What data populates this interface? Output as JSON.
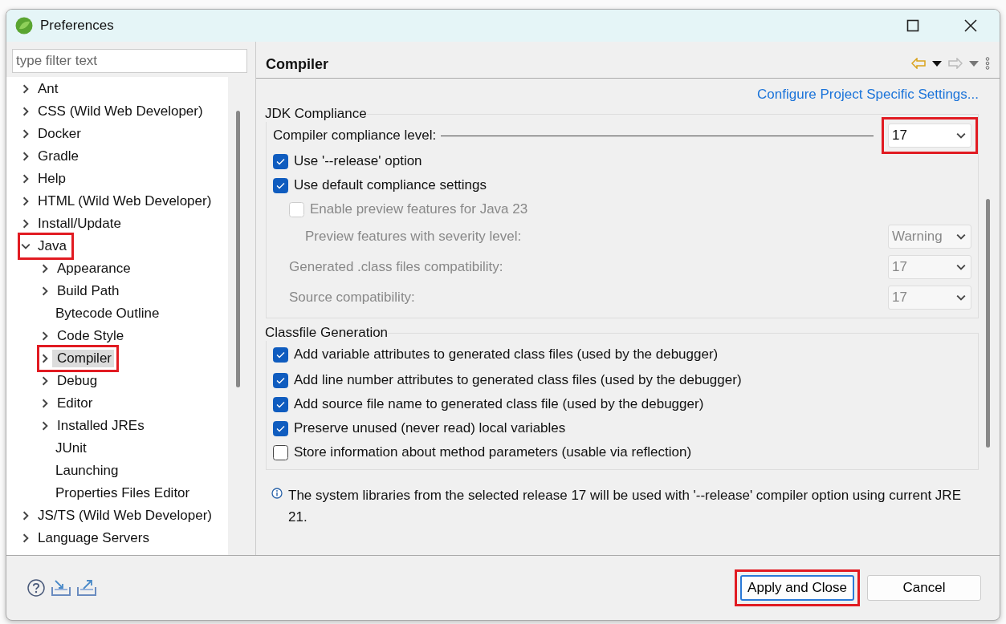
{
  "window": {
    "title": "Preferences"
  },
  "filter": {
    "placeholder": "type filter text"
  },
  "tree": [
    {
      "label": "Ant",
      "expandable": true,
      "expanded": false,
      "selected": false,
      "highlighted": false
    },
    {
      "label": "CSS (Wild Web Developer)",
      "expandable": true,
      "expanded": false,
      "selected": false,
      "highlighted": false
    },
    {
      "label": "Docker",
      "expandable": true,
      "expanded": false,
      "selected": false,
      "highlighted": false
    },
    {
      "label": "Gradle",
      "expandable": true,
      "expanded": false,
      "selected": false,
      "highlighted": false
    },
    {
      "label": "Help",
      "expandable": true,
      "expanded": false,
      "selected": false,
      "highlighted": false
    },
    {
      "label": "HTML (Wild Web Developer)",
      "expandable": true,
      "expanded": false,
      "selected": false,
      "highlighted": false
    },
    {
      "label": "Install/Update",
      "expandable": true,
      "expanded": false,
      "selected": false,
      "highlighted": false
    },
    {
      "label": "Java",
      "expandable": true,
      "expanded": true,
      "selected": false,
      "highlighted": true,
      "children": [
        {
          "label": "Appearance",
          "expandable": true,
          "expanded": false,
          "selected": false,
          "highlighted": false
        },
        {
          "label": "Build Path",
          "expandable": true,
          "expanded": false,
          "selected": false,
          "highlighted": false
        },
        {
          "label": "Bytecode Outline",
          "expandable": false,
          "selected": false,
          "highlighted": false
        },
        {
          "label": "Code Style",
          "expandable": true,
          "expanded": false,
          "selected": false,
          "highlighted": false
        },
        {
          "label": "Compiler",
          "expandable": true,
          "expanded": false,
          "selected": true,
          "highlighted": true
        },
        {
          "label": "Debug",
          "expandable": true,
          "expanded": false,
          "selected": false,
          "highlighted": false
        },
        {
          "label": "Editor",
          "expandable": true,
          "expanded": false,
          "selected": false,
          "highlighted": false
        },
        {
          "label": "Installed JREs",
          "expandable": true,
          "expanded": false,
          "selected": false,
          "highlighted": false
        },
        {
          "label": "JUnit",
          "expandable": false,
          "selected": false,
          "highlighted": false
        },
        {
          "label": "Launching",
          "expandable": false,
          "selected": false,
          "highlighted": false
        },
        {
          "label": "Properties Files Editor",
          "expandable": false,
          "selected": false,
          "highlighted": false
        }
      ]
    },
    {
      "label": "JS/TS (Wild Web Developer)",
      "expandable": true,
      "expanded": false,
      "selected": false,
      "highlighted": false
    },
    {
      "label": "Language Servers",
      "expandable": true,
      "expanded": false,
      "selected": false,
      "highlighted": false
    }
  ],
  "page": {
    "title": "Compiler",
    "back_enabled": true,
    "forward_enabled": false,
    "link": "Configure Project Specific Settings..."
  },
  "groups": [
    {
      "title": "JDK Compliance",
      "options": [
        {
          "kind": "combo",
          "label": "Compiler compliance level:",
          "value": "17",
          "disabled": false,
          "highlighted": true,
          "leader": true
        },
        {
          "kind": "checkbox",
          "label": "Use '--release' option",
          "checked": true,
          "disabled": false
        },
        {
          "kind": "checkbox",
          "label": "Use default compliance settings",
          "checked": true,
          "disabled": false,
          "children": [
            {
              "kind": "checkbox",
              "label": "Enable preview features for Java 23",
              "checked": false,
              "disabled": true,
              "children": [
                {
                  "kind": "combo",
                  "label": "Preview features with severity level:",
                  "value": "Warning",
                  "disabled": true,
                  "highlighted": false
                }
              ]
            },
            {
              "kind": "combo",
              "label": "Generated .class files compatibility:",
              "value": "17",
              "disabled": true,
              "highlighted": false
            },
            {
              "kind": "combo",
              "label": "Source compatibility:",
              "value": "17",
              "disabled": true,
              "highlighted": false
            }
          ]
        }
      ]
    },
    {
      "title": "Classfile Generation",
      "options": [
        {
          "kind": "checkbox",
          "label": "Add variable attributes to generated class files (used by the debugger)",
          "checked": true,
          "disabled": false
        },
        {
          "kind": "checkbox",
          "label": "Add line number attributes to generated class files (used by the debugger)",
          "checked": true,
          "disabled": false
        },
        {
          "kind": "checkbox",
          "label": "Add source file name to generated class file (used by the debugger)",
          "checked": true,
          "disabled": false
        },
        {
          "kind": "checkbox",
          "label": "Preserve unused (never read) local variables",
          "checked": true,
          "disabled": false
        },
        {
          "kind": "checkbox",
          "label": "Store information about method parameters (usable via reflection)",
          "checked": false,
          "disabled": false
        }
      ]
    }
  ],
  "info": "The system libraries from the selected release 17 will be used with '--release' compiler option using current JRE 21.",
  "buttons": [
    {
      "label": "Apply and Close",
      "default": true,
      "highlighted": true
    },
    {
      "label": "Cancel",
      "default": false,
      "highlighted": false
    }
  ]
}
